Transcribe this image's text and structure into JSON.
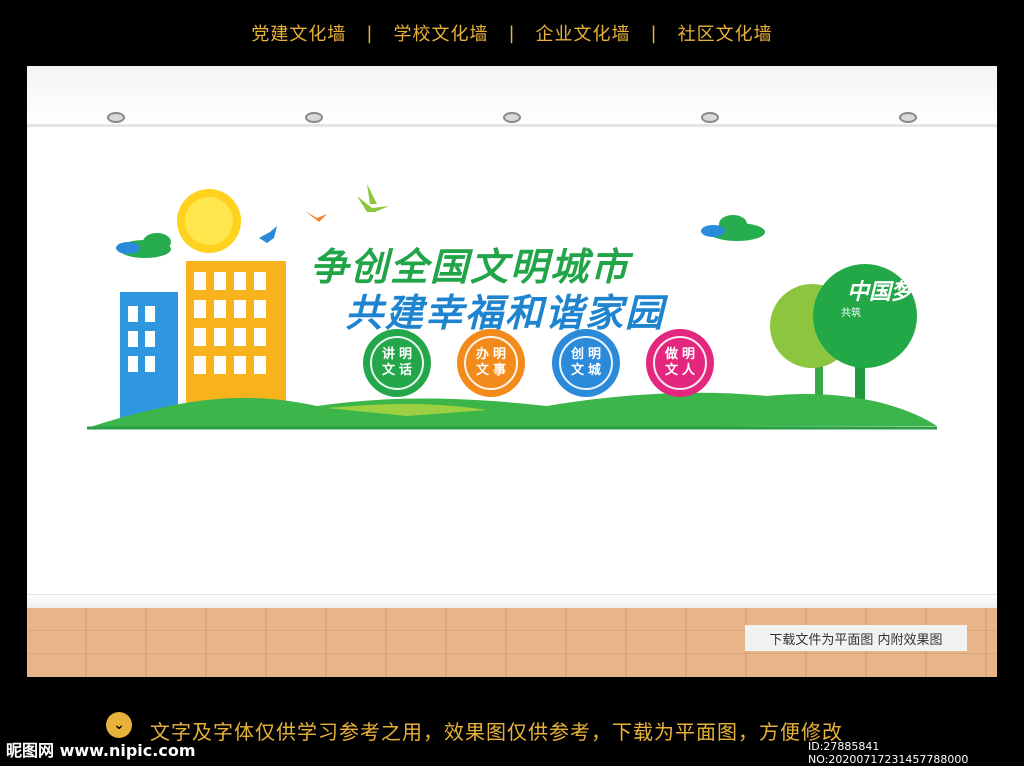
{
  "nav": {
    "items": [
      "党建文化墙",
      "学校文化墙",
      "企业文化墙",
      "社区文化墙"
    ],
    "separator": "|"
  },
  "banner": {
    "title_line1": "争创全国文明城市",
    "title_line2": "共建幸福和谐家园",
    "badges": [
      {
        "line1": "讲文",
        "line2": "明话",
        "color": "#23a74a"
      },
      {
        "line1": "办文",
        "line2": "明事",
        "color": "#f38a1c"
      },
      {
        "line1": "创文",
        "line2": "明城",
        "color": "#2b8ad9"
      },
      {
        "line1": "做文",
        "line2": "明人",
        "color": "#e3267e"
      }
    ],
    "tree_text": "中国梦",
    "tree_small": "共筑"
  },
  "note": "下载文件为平面图  内附效果图",
  "footer": {
    "icon": "chevron-down-icon",
    "text": "文字及字体仅供学习参考之用，效果图仅供参考，下载为平面图，方便修改",
    "logo": "昵图网 www.nipic.com",
    "id": "ID:27885841 NO:20200717231457788000"
  },
  "colors": {
    "accent": "#e8b23a",
    "green": "#22a548",
    "blue": "#1f84cf"
  }
}
